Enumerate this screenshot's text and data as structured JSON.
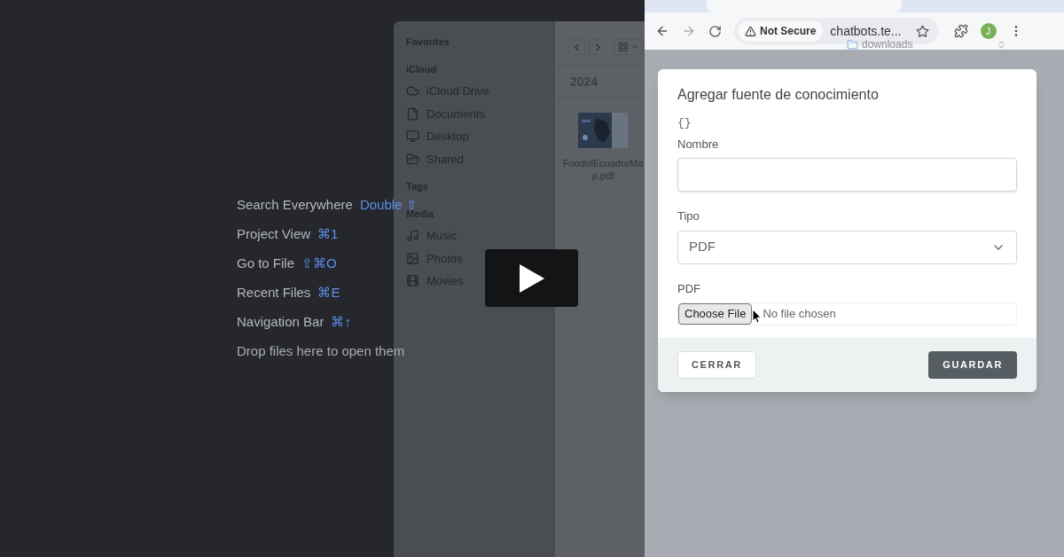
{
  "ide_welcome": {
    "shortcuts": [
      {
        "label": "Search Everywhere",
        "keys": "Double ⇧"
      },
      {
        "label": "Project View",
        "keys": "⌘1"
      },
      {
        "label": "Go to File",
        "keys": "⇧⌘O"
      },
      {
        "label": "Recent Files",
        "keys": "⌘E"
      },
      {
        "label": "Navigation Bar",
        "keys": "⌘↑"
      }
    ],
    "drop_hint": "Drop files here to open them"
  },
  "finder": {
    "sidebar": [
      {
        "heading": "Favorites"
      },
      {
        "heading": "iCloud",
        "items": [
          {
            "label": "iCloud Drive",
            "kind": "cloud"
          },
          {
            "label": "Documents",
            "kind": "document"
          },
          {
            "label": "Desktop",
            "kind": "desktop"
          },
          {
            "label": "Shared",
            "kind": "shared"
          }
        ]
      },
      {
        "heading": "Tags"
      },
      {
        "heading": "Media",
        "items": [
          {
            "label": "Music",
            "kind": "music"
          },
          {
            "label": "Photos",
            "kind": "photos"
          },
          {
            "label": "Movies",
            "kind": "movies"
          }
        ]
      }
    ],
    "group_title": "2024",
    "files": [
      {
        "name": "FoodofEcuadorMap.pdf"
      }
    ]
  },
  "browser": {
    "security_label": "Not Secure",
    "url": "chatbots.te...",
    "avatar": "J"
  },
  "file_dialog": {
    "location": "downloads"
  },
  "modal": {
    "title": "Agregar fuente de conocimiento",
    "icon_text": "{}",
    "fields": [
      {
        "kind": "text",
        "label": "Nombre"
      },
      {
        "kind": "select",
        "label": "Tipo",
        "value": "PDF"
      },
      {
        "kind": "file",
        "label": "PDF",
        "button": "Choose File",
        "status": "No file chosen"
      }
    ],
    "buttons": [
      {
        "label": "CERRAR",
        "kind": "secondary"
      },
      {
        "label": "GUARDAR",
        "kind": "primary"
      }
    ]
  }
}
